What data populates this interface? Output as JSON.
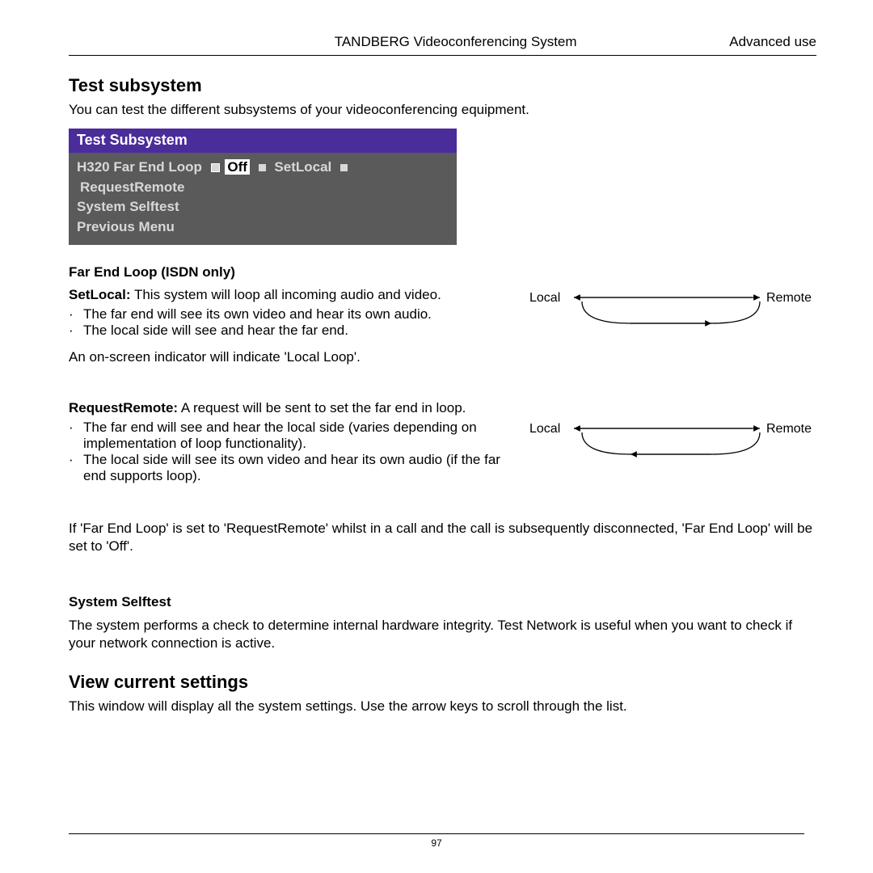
{
  "header": {
    "center": "TANDBERG Videoconferencing System",
    "right": "Advanced use"
  },
  "section1": {
    "title": "Test subsystem",
    "intro": "You can test the different subsystems of your videoconferencing equipment."
  },
  "menu": {
    "title": "Test Subsystem",
    "line1_label": "H320 Far End Loop",
    "opt_off": "Off",
    "opt_setlocal": "SetLocal",
    "opt_reqremote": "RequestRemote",
    "line2": "System Selftest",
    "line3": "Previous Menu"
  },
  "farend": {
    "heading": "Far End Loop (ISDN only)",
    "setlocal_label": "SetLocal:",
    "setlocal_text": " This system will loop all incoming audio and video.",
    "bullets1_a": "The far end will see its own video and hear its own audio.",
    "bullets1_b": "The local side will see and hear the far end.",
    "indicator": "An on-screen indicator will indicate 'Local Loop'.",
    "reqremote_label": "RequestRemote:",
    "reqremote_text": " A request will be sent to set the far end in loop.",
    "bullets2_a": "The far end will see and hear the local side (varies depending on implementation of loop functionality).",
    "bullets2_b": "The local side will see its own video and hear its own audio (if the far end supports loop).",
    "note": "If 'Far End Loop' is set to 'RequestRemote' whilst in a call and the call is subsequently disconnected, 'Far End Loop' will be set to 'Off'."
  },
  "diagram": {
    "local": "Local",
    "remote": "Remote"
  },
  "selftest": {
    "heading": "System Selftest",
    "text": "The system performs a check to determine internal hardware integrity. Test Network is useful when you want to check if your network connection is active."
  },
  "section2": {
    "title": "View current settings",
    "text": "This window will display all the system settings. Use the arrow keys to scroll through the list."
  },
  "footer": {
    "page": "97"
  }
}
